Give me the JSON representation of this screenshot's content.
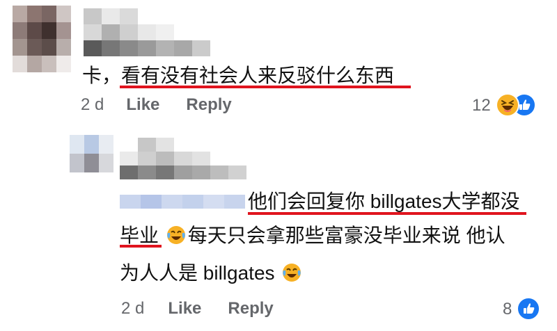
{
  "comment_1": {
    "text_prefix": "卡，",
    "text_underlined": "看有没有社会人来反驳什么东西",
    "time": "2 d",
    "like_label": "Like",
    "reply_label": "Reply",
    "reaction_count": "12",
    "reactions": [
      "laugh-icon",
      "like-icon"
    ]
  },
  "reply_1": {
    "line1_underlined": "他们会回复你 billgates大学都没",
    "line2_underlined": "毕业",
    "line2_emoji": "tears-of-joy-emoji",
    "line2_rest": "每天只会拿那些富豪没毕业来说 他认",
    "line3_text": "为人人是 billgates",
    "line3_emoji": "tears-of-joy-emoji",
    "time": "2 d",
    "like_label": "Like",
    "reply_label": "Reply",
    "reaction_count": "8",
    "reactions": [
      "like-icon"
    ]
  },
  "colors": {
    "highlight_underline": "#e0141e",
    "meta_gray": "#65676b",
    "like_blue": "#1877f2",
    "laugh_yellow": "#f7b125"
  }
}
